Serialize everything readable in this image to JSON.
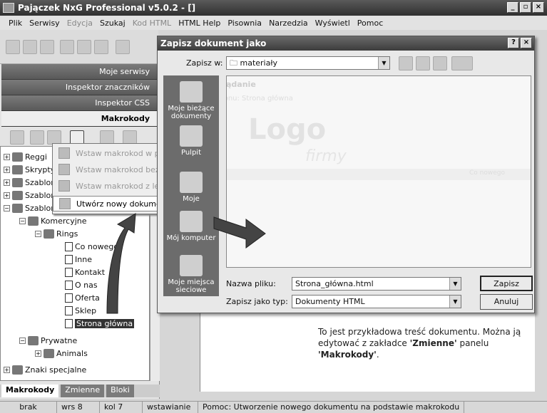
{
  "window": {
    "title": "Pajączek NxG Professional v5.0.2 - []",
    "controls": [
      "_",
      "▫",
      "×"
    ]
  },
  "menu": {
    "items": [
      {
        "label": "Plik",
        "enabled": true
      },
      {
        "label": "Serwisy",
        "enabled": true
      },
      {
        "label": "Edycja",
        "enabled": false
      },
      {
        "label": "Szukaj",
        "enabled": true
      },
      {
        "label": "Kod HTML",
        "enabled": false
      },
      {
        "label": "HTML Help",
        "enabled": true
      },
      {
        "label": "Pisownia",
        "enabled": true
      },
      {
        "label": "Narzedzia",
        "enabled": true
      },
      {
        "label": "Wyświetl",
        "enabled": true
      },
      {
        "label": "Pomoc",
        "enabled": true
      }
    ],
    "help_marker": "?"
  },
  "left_panel": {
    "sections": [
      "Moje serwisy",
      "Inspektor znaczników",
      "Inspektor CSS",
      "Makrokody"
    ],
    "tree": [
      {
        "label": "Reggi",
        "level": 0
      },
      {
        "label": "Skrypty JS",
        "level": 0
      },
      {
        "label": "Szablony",
        "level": 0
      },
      {
        "label": "Szablony",
        "level": 0
      },
      {
        "label": "Szablony serwisów",
        "level": 0
      },
      {
        "label": "Komercyjne",
        "level": 1
      },
      {
        "label": "Rings",
        "level": 2
      },
      {
        "label": "Co nowego",
        "level": 3
      },
      {
        "label": "Inne",
        "level": 3
      },
      {
        "label": "Kontakt",
        "level": 3
      },
      {
        "label": "O nas",
        "level": 3
      },
      {
        "label": "Oferta",
        "level": 3
      },
      {
        "label": "Sklep",
        "level": 3
      },
      {
        "label": "Strona główna",
        "level": 3,
        "selected": true
      },
      {
        "label": "Prywatne",
        "level": 1
      },
      {
        "label": "Animals",
        "level": 2
      },
      {
        "label": "Znaki specjalne",
        "level": 0
      }
    ],
    "tabs": [
      "Makrokody",
      "Zmienne",
      "Bloki"
    ]
  },
  "context_menu": {
    "items": [
      {
        "label": "Wstaw makrokod w pozycji kursora",
        "enabled": false
      },
      {
        "label": "Wstaw makrokod bez środka",
        "enabled": false
      },
      {
        "label": "Wstaw makrokod z lewą częścią do HEAD",
        "enabled": false
      },
      {
        "label": "Utwórz nowy dokument z makrokodu",
        "enabled": true
      }
    ]
  },
  "dialog": {
    "title": "Zapisz dokument jako",
    "help": "?",
    "save_in_label": "Zapisz w:",
    "save_in_value": "materiały",
    "places": [
      "Moje bieżące dokumenty",
      "Pulpit",
      "Moje",
      "Mój komputer",
      "Moje miejsca sieciowe"
    ],
    "filename_label": "Nazwa pliku:",
    "filename_value": "Strona_główna.html",
    "filetype_label": "Zapisz jako typ:",
    "filetype_value": "Dokumenty HTML",
    "save_button": "Zapisz",
    "cancel_button": "Anuluj"
  },
  "preview_bg": {
    "heading": "Przeglądanie",
    "template_text": "szablonu: Strona główna",
    "logo_word1": "Logo",
    "logo_word2": "firmy",
    "band_text": "Co nowego"
  },
  "editor": {
    "text_part1": "To jest przykładowa treść dokumentu. Można ją edytować z zakładce ",
    "text_bold1": "'Zmienne'",
    "text_part2": " panelu ",
    "text_bold2": "'Makrokody'",
    "text_part3": "."
  },
  "status": {
    "cells": [
      "brak",
      "wrs 8",
      "kol 7",
      "wstawianie",
      "Pomoc: Utworzenie nowego dokumentu na podstawie makrokodu"
    ]
  }
}
